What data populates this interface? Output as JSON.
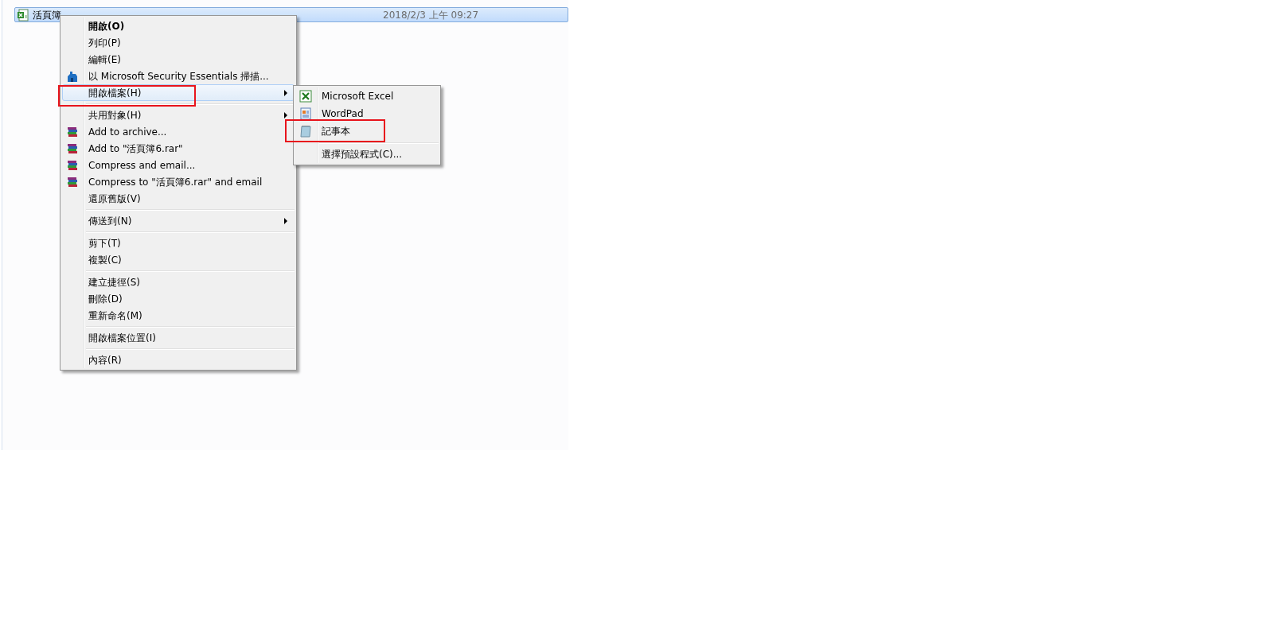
{
  "file_row": {
    "name": "活頁簿",
    "modified": "2018/2/3 上午 09:27",
    "selected": true
  },
  "context_menu": {
    "items": [
      {
        "kind": "plain",
        "label": "開啟(O)",
        "bold": true,
        "selected": false,
        "has_submenu": false,
        "marked": false
      },
      {
        "kind": "plain",
        "label": "列印(P)",
        "bold": false,
        "selected": false,
        "has_submenu": false,
        "marked": false
      },
      {
        "kind": "plain",
        "label": "編輯(E)",
        "bold": false,
        "selected": false,
        "has_submenu": false,
        "marked": false
      },
      {
        "kind": "scan",
        "label": "以 Microsoft Security Essentials 掃描...",
        "bold": false,
        "selected": false,
        "has_submenu": false,
        "marked": false
      },
      {
        "kind": "plain",
        "label": "開啟檔案(H)",
        "bold": false,
        "selected": true,
        "has_submenu": true,
        "marked": true
      },
      {
        "kind": "separator"
      },
      {
        "kind": "plain",
        "label": "共用對象(H)",
        "bold": false,
        "selected": false,
        "has_submenu": true,
        "marked": false
      },
      {
        "kind": "archive",
        "label": "Add to archive...",
        "bold": false,
        "selected": false,
        "has_submenu": false,
        "marked": false
      },
      {
        "kind": "archive",
        "label": "Add to \"活頁簿6.rar\"",
        "bold": false,
        "selected": false,
        "has_submenu": false,
        "marked": false
      },
      {
        "kind": "archive",
        "label": "Compress and email...",
        "bold": false,
        "selected": false,
        "has_submenu": false,
        "marked": false
      },
      {
        "kind": "archive",
        "label": "Compress to \"活頁簿6.rar\" and email",
        "bold": false,
        "selected": false,
        "has_submenu": false,
        "marked": false
      },
      {
        "kind": "plain",
        "label": "還原舊版(V)",
        "bold": false,
        "selected": false,
        "has_submenu": false,
        "marked": false
      },
      {
        "kind": "separator"
      },
      {
        "kind": "plain",
        "label": "傳送到(N)",
        "bold": false,
        "selected": false,
        "has_submenu": true,
        "marked": false
      },
      {
        "kind": "separator"
      },
      {
        "kind": "plain",
        "label": "剪下(T)",
        "bold": false,
        "selected": false,
        "has_submenu": false,
        "marked": false
      },
      {
        "kind": "plain",
        "label": "複製(C)",
        "bold": false,
        "selected": false,
        "has_submenu": false,
        "marked": false
      },
      {
        "kind": "separator"
      },
      {
        "kind": "plain",
        "label": "建立捷徑(S)",
        "bold": false,
        "selected": false,
        "has_submenu": false,
        "marked": false
      },
      {
        "kind": "plain",
        "label": "刪除(D)",
        "bold": false,
        "selected": false,
        "has_submenu": false,
        "marked": false
      },
      {
        "kind": "plain",
        "label": "重新命名(M)",
        "bold": false,
        "selected": false,
        "has_submenu": false,
        "marked": false
      },
      {
        "kind": "separator"
      },
      {
        "kind": "plain",
        "label": "開啟檔案位置(I)",
        "bold": false,
        "selected": false,
        "has_submenu": false,
        "marked": false
      },
      {
        "kind": "separator"
      },
      {
        "kind": "plain",
        "label": "內容(R)",
        "bold": false,
        "selected": false,
        "has_submenu": false,
        "marked": false
      }
    ]
  },
  "submenu": {
    "items": [
      {
        "kind": "excel",
        "label": "Microsoft Excel",
        "selected": false,
        "marked": false
      },
      {
        "kind": "wordpad",
        "label": "WordPad",
        "selected": false,
        "marked": false
      },
      {
        "kind": "notepad",
        "label": "記事本",
        "selected": false,
        "marked": true
      },
      {
        "kind": "separator"
      },
      {
        "kind": "plain",
        "label": "選擇預設程式(C)...",
        "selected": false,
        "marked": false
      }
    ]
  }
}
